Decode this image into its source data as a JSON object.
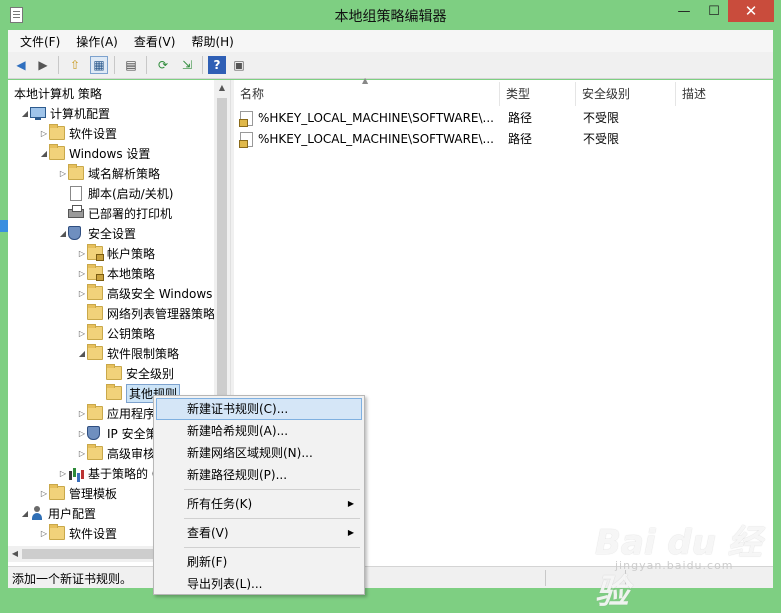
{
  "window": {
    "title": "本地组策略编辑器"
  },
  "titlebar_buttons": {
    "minimize": "—",
    "maximize": "☐",
    "close": "✕"
  },
  "menubar": [
    "文件(F)",
    "操作(A)",
    "查看(V)",
    "帮助(H)"
  ],
  "toolbar": {
    "back": "◀",
    "forward": "▶",
    "up": "⇧",
    "show_tree": "▦",
    "properties": "▤",
    "refresh": "⟳",
    "export": "⇲",
    "help": "?",
    "console": "▣"
  },
  "tree": [
    {
      "label": "本地计算机 策略",
      "icon": "none",
      "toggle": "",
      "indent": 0
    },
    {
      "label": "计算机配置",
      "icon": "computer-icon",
      "toggle": "◢",
      "indent": 0
    },
    {
      "label": "软件设置",
      "icon": "folder-icon",
      "toggle": "▷",
      "indent": 1
    },
    {
      "label": "Windows 设置",
      "icon": "folder-icon",
      "toggle": "◢",
      "indent": 1
    },
    {
      "label": "域名解析策略",
      "icon": "folder-icon",
      "toggle": "▷",
      "indent": 2
    },
    {
      "label": "脚本(启动/关机)",
      "icon": "document-icon",
      "toggle": "",
      "indent": 2
    },
    {
      "label": "已部署的打印机",
      "icon": "printer-icon",
      "toggle": "",
      "indent": 2
    },
    {
      "label": "安全设置",
      "icon": "security-icon",
      "toggle": "◢",
      "indent": 2
    },
    {
      "label": "帐户策略",
      "icon": "locked-folder-icon",
      "toggle": "▷",
      "indent": 3
    },
    {
      "label": "本地策略",
      "icon": "locked-folder-icon",
      "toggle": "▷",
      "indent": 3
    },
    {
      "label": "高级安全 Windows 防",
      "icon": "folder-icon",
      "toggle": "▷",
      "indent": 3
    },
    {
      "label": "网络列表管理器策略",
      "icon": "folder-icon",
      "toggle": "",
      "indent": 3
    },
    {
      "label": "公钥策略",
      "icon": "folder-icon",
      "toggle": "▷",
      "indent": 3
    },
    {
      "label": "软件限制策略",
      "icon": "folder-icon",
      "toggle": "◢",
      "indent": 3
    },
    {
      "label": "安全级别",
      "icon": "folder-icon",
      "toggle": "",
      "indent": 4
    },
    {
      "label": "其他规则",
      "icon": "folder-icon",
      "toggle": "",
      "indent": 4,
      "selected": true
    },
    {
      "label": "应用程序控",
      "icon": "folder-icon",
      "toggle": "▷",
      "indent": 3
    },
    {
      "label": "IP 安全策略",
      "icon": "ip-security-icon",
      "toggle": "▷",
      "indent": 3
    },
    {
      "label": "高级审核策",
      "icon": "folder-icon",
      "toggle": "▷",
      "indent": 3
    },
    {
      "label": "基于策略的 Q",
      "icon": "chart-icon",
      "toggle": "▷",
      "indent": 2
    },
    {
      "label": "管理模板",
      "icon": "folder-icon",
      "toggle": "▷",
      "indent": 1
    },
    {
      "label": "用户配置",
      "icon": "user-icon",
      "toggle": "◢",
      "indent": 0
    },
    {
      "label": "软件设置",
      "icon": "folder-icon",
      "toggle": "▷",
      "indent": 1
    }
  ],
  "list": {
    "columns": [
      "名称",
      "类型",
      "安全级别",
      "描述"
    ],
    "sort_indicator": "▲",
    "rows": [
      {
        "name": "%HKEY_LOCAL_MACHINE\\SOFTWARE\\...",
        "type": "路径",
        "level": "不受限",
        "desc": ""
      },
      {
        "name": "%HKEY_LOCAL_MACHINE\\SOFTWARE\\...",
        "type": "路径",
        "level": "不受限",
        "desc": ""
      }
    ]
  },
  "context_menu": [
    {
      "label": "新建证书规则(C)...",
      "active": true
    },
    {
      "label": "新建哈希规则(A)..."
    },
    {
      "label": "新建网络区域规则(N)..."
    },
    {
      "label": "新建路径规则(P)..."
    },
    {
      "separator": true
    },
    {
      "label": "所有任务(K)",
      "submenu": true
    },
    {
      "separator": true
    },
    {
      "label": "查看(V)",
      "submenu": true
    },
    {
      "separator": true
    },
    {
      "label": "刷新(F)"
    },
    {
      "label": "导出列表(L)..."
    }
  ],
  "context_menu_arrow": "▶",
  "status": {
    "text": "添加一个新证书规则。"
  },
  "watermark": {
    "logo": "Bai du 经验",
    "url": "jingyan.baidu.com"
  },
  "colors": {
    "window_frame": "#7ecf82",
    "close_button": "#c94c3c",
    "selection": "#cce4f7",
    "menu_highlight": "#d5e6f7"
  }
}
